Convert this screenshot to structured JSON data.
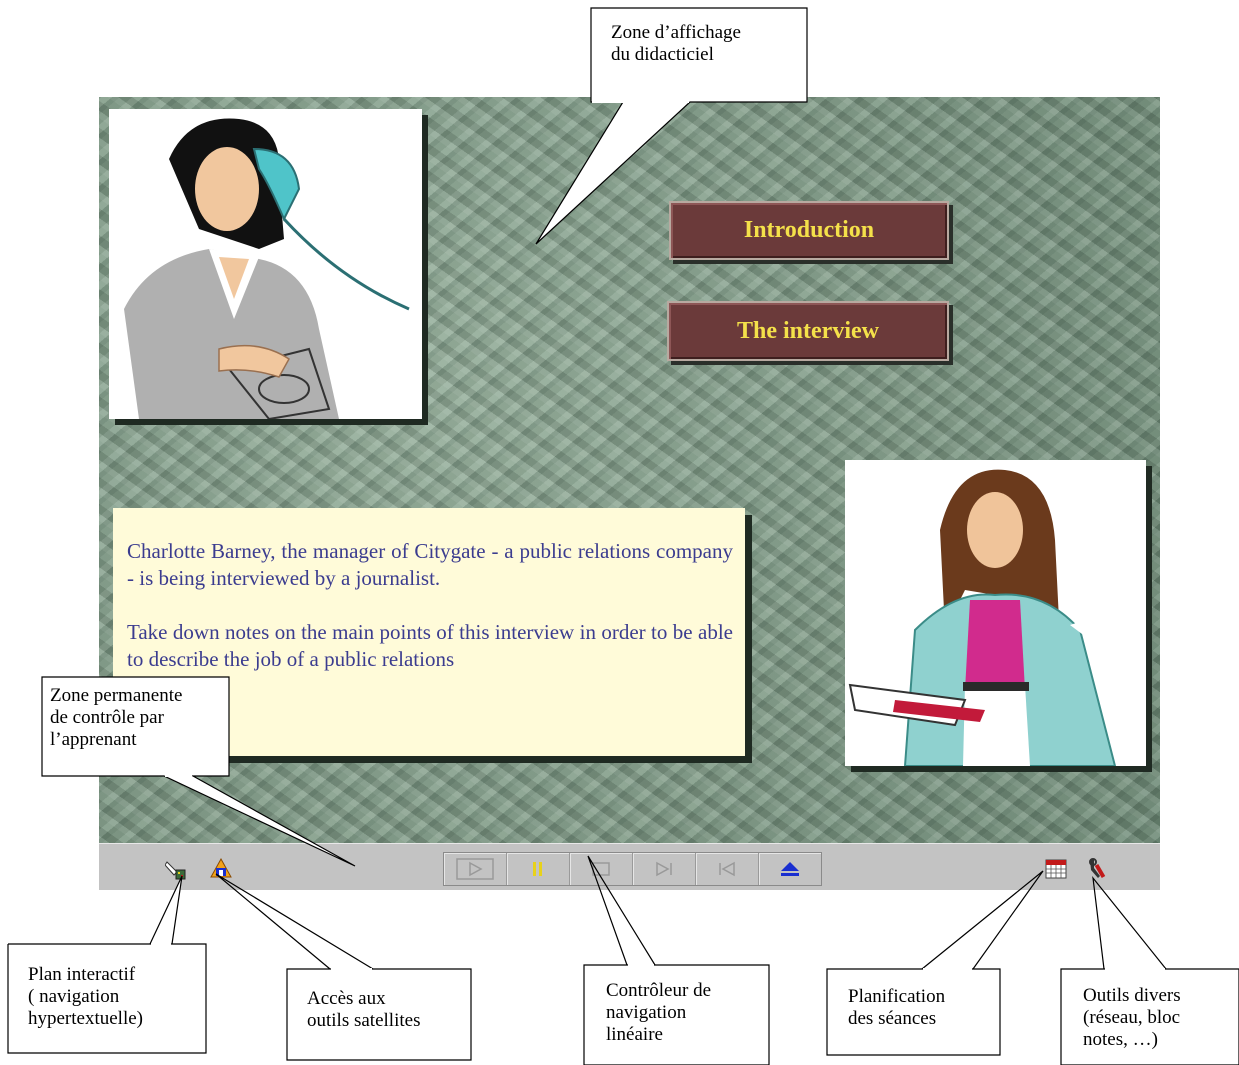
{
  "screen": {
    "buttons": [
      {
        "label": "Introduction"
      },
      {
        "label": "The interview"
      }
    ],
    "text": {
      "paragraph1": "Charlotte Barney, the manager of Citygate - a public relations company - is being interviewed by a journalist.",
      "paragraph2": "Take down notes on the main points of this interview in order to be able to describe the job of a public relations"
    }
  },
  "control_bar": {
    "left_icons": [
      "interactive-plan-icon",
      "satellite-tools-icon"
    ],
    "nav_buttons": [
      "play-icon",
      "pause-icon",
      "stop-icon",
      "next-icon",
      "previous-icon",
      "eject-icon"
    ],
    "right_icons": [
      "calendar-icon",
      "tools-icon"
    ],
    "colors": {
      "bar": "#c3c3c3",
      "pause": "#e8d21a",
      "eject": "#1a2fd0"
    }
  },
  "callouts": {
    "display_zone": [
      "Zone d’affichage",
      "du didacticiel"
    ],
    "control_zone": [
      "Zone permanente",
      "de contrôle par",
      "l’apprenant"
    ],
    "interactive_plan": [
      "Plan interactif",
      "( navigation",
      "hypertextuelle)"
    ],
    "satellite_tools": [
      "Accès aux",
      "outils satellites"
    ],
    "linear_nav": [
      "Contrôleur de",
      "navigation",
      "linéaire"
    ],
    "sessions": [
      "Planification",
      "des séances"
    ],
    "misc_tools": [
      "Outils divers",
      "(réseau, bloc",
      "notes, …)"
    ]
  },
  "colors": {
    "button_bg": "#6b3a3a",
    "button_text": "#f4e14a",
    "text_box_bg": "#fffbd9",
    "body_text": "#3b3c8f",
    "background": "#7f9a86"
  }
}
